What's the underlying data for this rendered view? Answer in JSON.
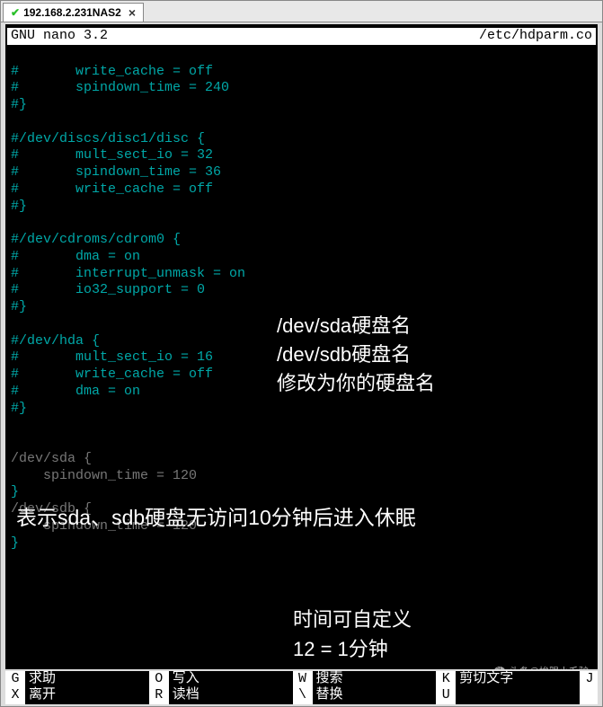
{
  "tab": {
    "title": "192.168.2.231NAS2"
  },
  "editor": {
    "app": "GNU nano 3.2",
    "filepath": "/etc/hdparm.co"
  },
  "content": {
    "lines": [
      "",
      "#       write_cache = off",
      "#       spindown_time = 240",
      "#}",
      "",
      "#/dev/discs/disc1/disc {",
      "#       mult_sect_io = 32",
      "#       spindown_time = 36",
      "#       write_cache = off",
      "#}",
      "",
      "#/dev/cdroms/cdrom0 {",
      "#       dma = on",
      "#       interrupt_unmask = on",
      "#       io32_support = 0",
      "#}",
      "",
      "#/dev/hda {",
      "#       mult_sect_io = 16",
      "#       write_cache = off",
      "#       dma = on",
      "#}",
      "",
      "",
      "/dev/sda {",
      "    spindown_time = 120",
      "}",
      "/dev/sdb {",
      "    spindown_time = 120",
      "}"
    ]
  },
  "annotations": {
    "a1_l1": "/dev/sda硬盘名",
    "a1_l2": "/dev/sdb硬盘名",
    "a1_l3": "修改为你的硬盘名",
    "a2": "表示sda、sdb硬盘无访问10分钟后进入休眠",
    "a3_l1": "时间可自定义",
    "a3_l2": "12 = 1分钟"
  },
  "help": {
    "r1c1_k": "G",
    "r1c1_l": "求助",
    "r1c2_k": "O",
    "r1c2_l": "写入",
    "r1c3_k": "W",
    "r1c3_l": "搜索",
    "r1c4_k": "K",
    "r1c4_l": "剪切文字",
    "r1c5_k": "J",
    "r2c1_k": "X",
    "r2c1_l": "离开",
    "r2c2_k": "R",
    "r2c2_l": "读档",
    "r2c3_k": "\\",
    "r2c3_l": "替换",
    "r2c4_k": "U",
    "r2c4_l": "",
    "r2c5_k": ""
  },
  "watermark": "头条@挨踢小毛驴"
}
